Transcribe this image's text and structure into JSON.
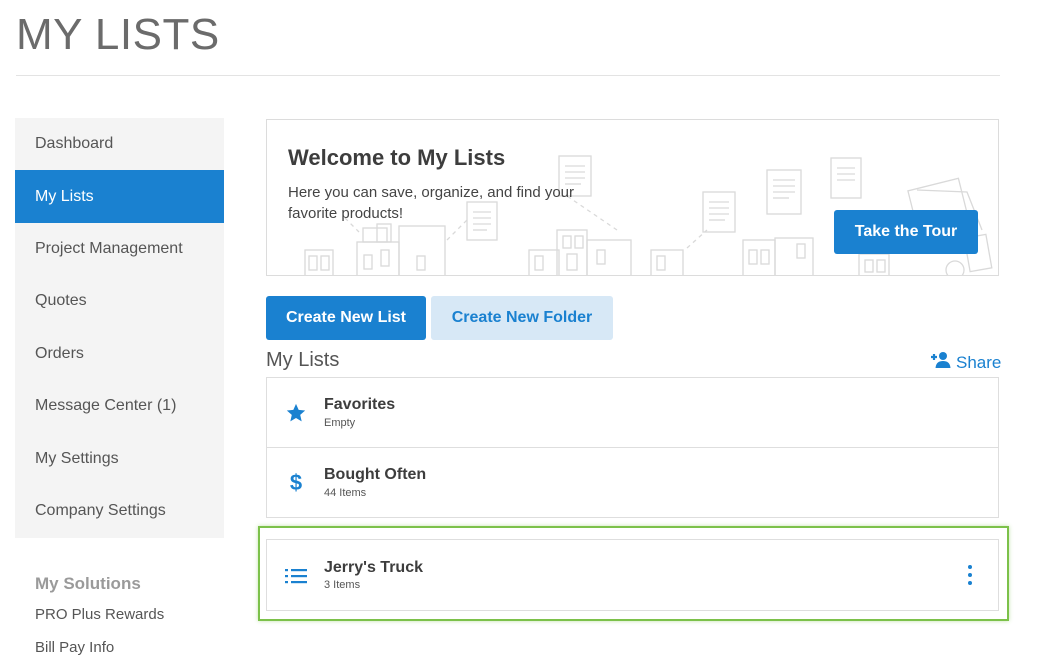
{
  "page": {
    "title": "MY LISTS"
  },
  "sidebar": {
    "items": [
      {
        "label": "Dashboard"
      },
      {
        "label": "My Lists"
      },
      {
        "label": "Project Management"
      },
      {
        "label": "Quotes"
      },
      {
        "label": "Orders"
      },
      {
        "label": "Message Center (1)"
      },
      {
        "label": "My Settings"
      },
      {
        "label": "Company Settings"
      }
    ],
    "active_index": 1
  },
  "solutions": {
    "title": "My Solutions",
    "links": [
      {
        "label": "PRO Plus Rewards"
      },
      {
        "label": "Bill Pay Info"
      }
    ]
  },
  "banner": {
    "title": "Welcome to My Lists",
    "text": "Here you can save, organize, and find your favorite products!",
    "tour_button": "Take the Tour"
  },
  "actions": {
    "create_list": "Create New List",
    "create_folder": "Create New Folder"
  },
  "lists_section": {
    "title": "My Lists",
    "share_label": "Share",
    "share_icon": "add-person-icon",
    "items": [
      {
        "name": "Favorites",
        "sub": "Empty",
        "icon": "star-icon"
      },
      {
        "name": "Bought Often",
        "sub": "44 Items",
        "icon": "dollar-icon"
      },
      {
        "name": "Jerry's Truck",
        "sub": "3 Items",
        "icon": "list-icon",
        "highlighted": true
      }
    ]
  },
  "colors": {
    "accent": "#1a81d0",
    "accent_light": "#d7e8f6",
    "highlight": "#7cc14a",
    "sidebar_bg": "#f4f4f4"
  }
}
